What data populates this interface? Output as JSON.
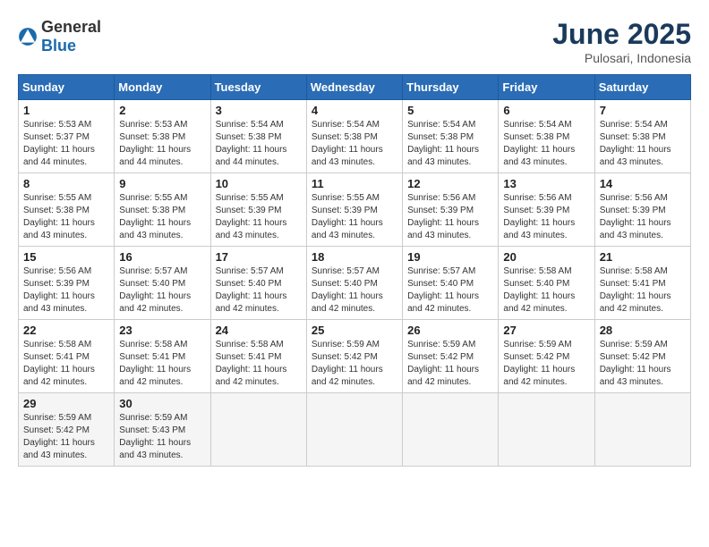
{
  "logo": {
    "text_general": "General",
    "text_blue": "Blue"
  },
  "title": "June 2025",
  "subtitle": "Pulosari, Indonesia",
  "weekdays": [
    "Sunday",
    "Monday",
    "Tuesday",
    "Wednesday",
    "Thursday",
    "Friday",
    "Saturday"
  ],
  "weeks": [
    [
      {
        "day": "1",
        "sunrise": "5:53 AM",
        "sunset": "5:37 PM",
        "daylight": "11 hours and 44 minutes."
      },
      {
        "day": "2",
        "sunrise": "5:53 AM",
        "sunset": "5:38 PM",
        "daylight": "11 hours and 44 minutes."
      },
      {
        "day": "3",
        "sunrise": "5:54 AM",
        "sunset": "5:38 PM",
        "daylight": "11 hours and 44 minutes."
      },
      {
        "day": "4",
        "sunrise": "5:54 AM",
        "sunset": "5:38 PM",
        "daylight": "11 hours and 43 minutes."
      },
      {
        "day": "5",
        "sunrise": "5:54 AM",
        "sunset": "5:38 PM",
        "daylight": "11 hours and 43 minutes."
      },
      {
        "day": "6",
        "sunrise": "5:54 AM",
        "sunset": "5:38 PM",
        "daylight": "11 hours and 43 minutes."
      },
      {
        "day": "7",
        "sunrise": "5:54 AM",
        "sunset": "5:38 PM",
        "daylight": "11 hours and 43 minutes."
      }
    ],
    [
      {
        "day": "8",
        "sunrise": "5:55 AM",
        "sunset": "5:38 PM",
        "daylight": "11 hours and 43 minutes."
      },
      {
        "day": "9",
        "sunrise": "5:55 AM",
        "sunset": "5:38 PM",
        "daylight": "11 hours and 43 minutes."
      },
      {
        "day": "10",
        "sunrise": "5:55 AM",
        "sunset": "5:39 PM",
        "daylight": "11 hours and 43 minutes."
      },
      {
        "day": "11",
        "sunrise": "5:55 AM",
        "sunset": "5:39 PM",
        "daylight": "11 hours and 43 minutes."
      },
      {
        "day": "12",
        "sunrise": "5:56 AM",
        "sunset": "5:39 PM",
        "daylight": "11 hours and 43 minutes."
      },
      {
        "day": "13",
        "sunrise": "5:56 AM",
        "sunset": "5:39 PM",
        "daylight": "11 hours and 43 minutes."
      },
      {
        "day": "14",
        "sunrise": "5:56 AM",
        "sunset": "5:39 PM",
        "daylight": "11 hours and 43 minutes."
      }
    ],
    [
      {
        "day": "15",
        "sunrise": "5:56 AM",
        "sunset": "5:39 PM",
        "daylight": "11 hours and 43 minutes."
      },
      {
        "day": "16",
        "sunrise": "5:57 AM",
        "sunset": "5:40 PM",
        "daylight": "11 hours and 42 minutes."
      },
      {
        "day": "17",
        "sunrise": "5:57 AM",
        "sunset": "5:40 PM",
        "daylight": "11 hours and 42 minutes."
      },
      {
        "day": "18",
        "sunrise": "5:57 AM",
        "sunset": "5:40 PM",
        "daylight": "11 hours and 42 minutes."
      },
      {
        "day": "19",
        "sunrise": "5:57 AM",
        "sunset": "5:40 PM",
        "daylight": "11 hours and 42 minutes."
      },
      {
        "day": "20",
        "sunrise": "5:58 AM",
        "sunset": "5:40 PM",
        "daylight": "11 hours and 42 minutes."
      },
      {
        "day": "21",
        "sunrise": "5:58 AM",
        "sunset": "5:41 PM",
        "daylight": "11 hours and 42 minutes."
      }
    ],
    [
      {
        "day": "22",
        "sunrise": "5:58 AM",
        "sunset": "5:41 PM",
        "daylight": "11 hours and 42 minutes."
      },
      {
        "day": "23",
        "sunrise": "5:58 AM",
        "sunset": "5:41 PM",
        "daylight": "11 hours and 42 minutes."
      },
      {
        "day": "24",
        "sunrise": "5:58 AM",
        "sunset": "5:41 PM",
        "daylight": "11 hours and 42 minutes."
      },
      {
        "day": "25",
        "sunrise": "5:59 AM",
        "sunset": "5:42 PM",
        "daylight": "11 hours and 42 minutes."
      },
      {
        "day": "26",
        "sunrise": "5:59 AM",
        "sunset": "5:42 PM",
        "daylight": "11 hours and 42 minutes."
      },
      {
        "day": "27",
        "sunrise": "5:59 AM",
        "sunset": "5:42 PM",
        "daylight": "11 hours and 42 minutes."
      },
      {
        "day": "28",
        "sunrise": "5:59 AM",
        "sunset": "5:42 PM",
        "daylight": "11 hours and 43 minutes."
      }
    ],
    [
      {
        "day": "29",
        "sunrise": "5:59 AM",
        "sunset": "5:42 PM",
        "daylight": "11 hours and 43 minutes."
      },
      {
        "day": "30",
        "sunrise": "5:59 AM",
        "sunset": "5:43 PM",
        "daylight": "11 hours and 43 minutes."
      },
      null,
      null,
      null,
      null,
      null
    ]
  ]
}
